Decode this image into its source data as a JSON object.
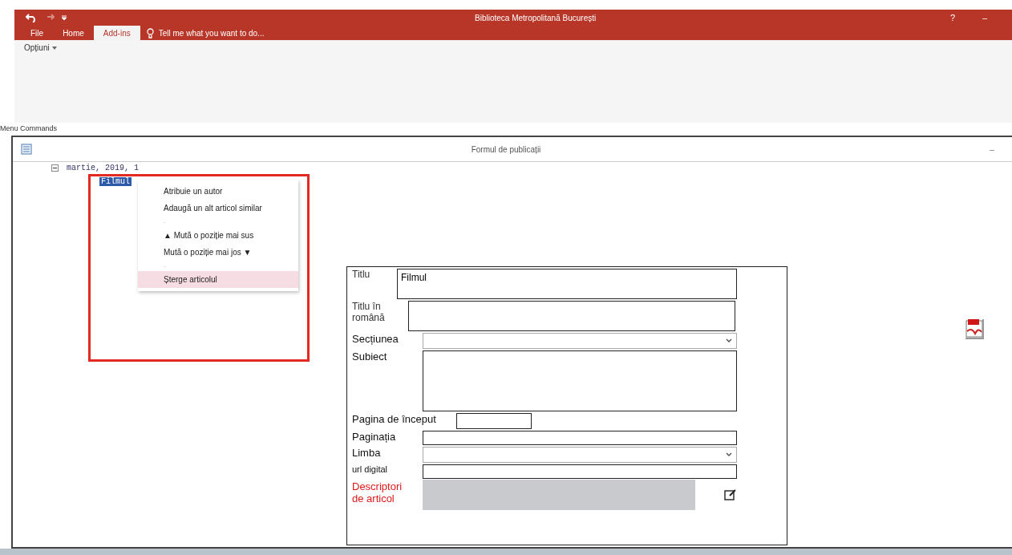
{
  "window": {
    "title": "Biblioteca Metropolitană București",
    "help": "?",
    "minimize": "–"
  },
  "ribbon_tabs": [
    {
      "label": "File",
      "selected": false
    },
    {
      "label": "Home",
      "selected": false
    },
    {
      "label": "Add-ins",
      "selected": true
    }
  ],
  "tell_me": {
    "placeholder": "Tell me what you want to do..."
  },
  "ribbon": {
    "menu_label": "Opțiuni",
    "group_label": "Menu Commands"
  },
  "form_window": {
    "title": "Formul de publicații",
    "minimize": "–"
  },
  "tree": [
    {
      "label": "martie, 2019, 1",
      "expanded": true,
      "selected": false,
      "children": [
        {
          "label": "Filmul",
          "selected": true
        }
      ]
    }
  ],
  "context_menu": [
    {
      "kind": "item",
      "label": "Atribuie un autor",
      "selected": false
    },
    {
      "kind": "item",
      "label": "Adaugă un alt articol similar",
      "selected": false
    },
    {
      "kind": "separator",
      "label": "-"
    },
    {
      "kind": "item",
      "label": "▲ Mută o poziție mai sus",
      "selected": false
    },
    {
      "kind": "item",
      "label": "Mută o poziție mai jos ▼",
      "selected": false
    },
    {
      "kind": "separator",
      "label": "-"
    },
    {
      "kind": "item",
      "label": "Șterge articolul",
      "selected": true
    }
  ],
  "form": [
    {
      "kind": "textarea",
      "label": "Titlu",
      "value": "Filmul"
    },
    {
      "kind": "textarea",
      "label": "Titlu în română"
    },
    {
      "kind": "select",
      "label": "Secțiunea"
    },
    {
      "kind": "textarea_tall",
      "label": "Subiect"
    },
    {
      "kind": "short",
      "label": "Pagina de început"
    },
    {
      "kind": "text",
      "label": "Paginația"
    },
    {
      "kind": "select",
      "label": "Limba"
    },
    {
      "kind": "small",
      "label": "url digital"
    },
    {
      "kind": "descriptor",
      "label": "Descriptori de articol"
    }
  ]
}
